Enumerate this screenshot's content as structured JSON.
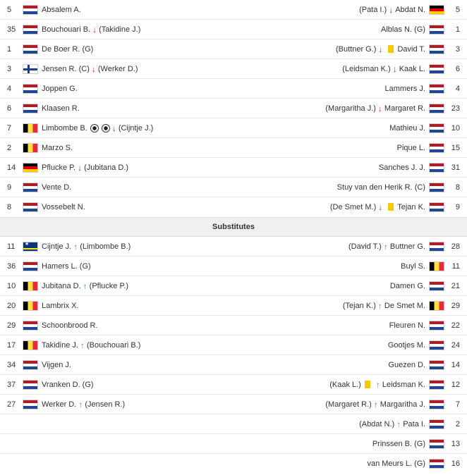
{
  "starting": [
    {
      "l_num": "5",
      "l_flag": "nl",
      "l_name": "Absalem A.",
      "l_extra": "",
      "r_pre": "(Pata I.)",
      "r_event": "down",
      "r_name": "Abdat N.",
      "r_flag": "de",
      "r_num": "5"
    },
    {
      "l_num": "35",
      "l_flag": "nl",
      "l_name": "Bouchouari B.",
      "l_event": "down",
      "l_extra": "(Takidine J.)",
      "r_pre": "",
      "r_event": "",
      "r_name": "Alblas N. (G)",
      "r_flag": "nl",
      "r_num": "1"
    },
    {
      "l_num": "1",
      "l_flag": "nl",
      "l_name": "De Boer R. (G)",
      "l_extra": "",
      "r_pre": "(Buttner G.)",
      "r_event": "down-yellow",
      "r_name": "David T.",
      "r_flag": "nl",
      "r_num": "3"
    },
    {
      "l_num": "3",
      "l_flag": "fi",
      "l_name": "Jensen R. (C)",
      "l_event": "down",
      "l_extra": "(Werker D.)",
      "r_pre": "(Leidsman K.)",
      "r_event": "down",
      "r_name": "Kaak L.",
      "r_flag": "nl",
      "r_num": "6"
    },
    {
      "l_num": "4",
      "l_flag": "nl",
      "l_name": "Joppen G.",
      "l_extra": "",
      "r_pre": "",
      "r_event": "",
      "r_name": "Lammers J.",
      "r_flag": "nl",
      "r_num": "4"
    },
    {
      "l_num": "6",
      "l_flag": "nl",
      "l_name": "Klaasen R.",
      "l_extra": "",
      "r_pre": "(Margaritha J.)",
      "r_event": "down",
      "r_name": "Margaret R.",
      "r_flag": "nl",
      "r_num": "23"
    },
    {
      "l_num": "7",
      "l_flag": "be",
      "l_name": "Limbombe B.",
      "l_event": "balls-down",
      "l_extra": "(Cijntje J.)",
      "r_pre": "",
      "r_event": "",
      "r_name": "Mathieu J.",
      "r_flag": "nl",
      "r_num": "10"
    },
    {
      "l_num": "2",
      "l_flag": "be",
      "l_name": "Marzo S.",
      "l_extra": "",
      "r_pre": "",
      "r_event": "",
      "r_name": "Pique L.",
      "r_flag": "nl",
      "r_num": "15"
    },
    {
      "l_num": "14",
      "l_flag": "de",
      "l_name": "Pflucke P.",
      "l_event": "down",
      "l_extra": "(Jubitana D.)",
      "r_pre": "",
      "r_event": "",
      "r_name": "Sanches J. J.",
      "r_flag": "nl",
      "r_num": "31"
    },
    {
      "l_num": "9",
      "l_flag": "nl",
      "l_name": "Vente D.",
      "l_extra": "",
      "r_pre": "",
      "r_event": "",
      "r_name": "Stuy van den Herik R. (C)",
      "r_flag": "nl",
      "r_num": "8"
    },
    {
      "l_num": "8",
      "l_flag": "nl",
      "l_name": "Vossebelt N.",
      "l_extra": "",
      "r_pre": "(De Smet M.)",
      "r_event": "down-yellow",
      "r_name": "Tejan K.",
      "r_flag": "nl",
      "r_num": "9"
    }
  ],
  "section_label": "Substitutes",
  "subs": [
    {
      "l_num": "11",
      "l_flag": "cw",
      "l_name": "Cijntje J.",
      "l_event": "up",
      "l_extra": "(Limbombe B.)",
      "r_pre": "(David T.)",
      "r_event": "up",
      "r_name": "Buttner G.",
      "r_flag": "nl",
      "r_num": "28"
    },
    {
      "l_num": "36",
      "l_flag": "nl",
      "l_name": "Hamers L. (G)",
      "l_extra": "",
      "r_pre": "",
      "r_event": "",
      "r_name": "Buyl S.",
      "r_flag": "be",
      "r_num": "11"
    },
    {
      "l_num": "10",
      "l_flag": "be",
      "l_name": "Jubitana D.",
      "l_event": "up",
      "l_extra": "(Pflucke P.)",
      "r_pre": "",
      "r_event": "",
      "r_name": "Damen G.",
      "r_flag": "nl",
      "r_num": "21"
    },
    {
      "l_num": "20",
      "l_flag": "be",
      "l_name": "Lambrix X.",
      "l_extra": "",
      "r_pre": "(Tejan K.)",
      "r_event": "up",
      "r_name": "De Smet M.",
      "r_flag": "be",
      "r_num": "29"
    },
    {
      "l_num": "29",
      "l_flag": "nl",
      "l_name": "Schoonbrood R.",
      "l_extra": "",
      "r_pre": "",
      "r_event": "",
      "r_name": "Fleuren N.",
      "r_flag": "nl",
      "r_num": "22"
    },
    {
      "l_num": "17",
      "l_flag": "be",
      "l_name": "Takidine J.",
      "l_event": "up",
      "l_extra": "(Bouchouari B.)",
      "r_pre": "",
      "r_event": "",
      "r_name": "Gootjes M.",
      "r_flag": "nl",
      "r_num": "24"
    },
    {
      "l_num": "34",
      "l_flag": "nl",
      "l_name": "Vijgen J.",
      "l_extra": "",
      "r_pre": "",
      "r_event": "",
      "r_name": "Guezen D.",
      "r_flag": "nl",
      "r_num": "14"
    },
    {
      "l_num": "37",
      "l_flag": "nl",
      "l_name": "Vranken D. (G)",
      "l_extra": "",
      "r_pre": "(Kaak L.)",
      "r_event": "yellow-up",
      "r_name": "Leidsman K.",
      "r_flag": "nl",
      "r_num": "12"
    },
    {
      "l_num": "27",
      "l_flag": "nl",
      "l_name": "Werker D.",
      "l_event": "up",
      "l_extra": "(Jensen R.)",
      "r_pre": "(Margaret R.)",
      "r_event": "up",
      "r_name": "Margaritha J.",
      "r_flag": "nl",
      "r_num": "7"
    },
    {
      "l_num": "",
      "l_flag": "",
      "l_name": "",
      "l_extra": "",
      "r_pre": "(Abdat N.)",
      "r_event": "up",
      "r_name": "Pata I.",
      "r_flag": "nl",
      "r_num": "2"
    },
    {
      "l_num": "",
      "l_flag": "",
      "l_name": "",
      "l_extra": "",
      "r_pre": "",
      "r_event": "",
      "r_name": "Prinssen B. (G)",
      "r_flag": "nl",
      "r_num": "13"
    },
    {
      "l_num": "",
      "l_flag": "",
      "l_name": "",
      "l_extra": "",
      "r_pre": "",
      "r_event": "",
      "r_name": "van Meurs L. (G)",
      "r_flag": "nl",
      "r_num": "16"
    }
  ],
  "icons": {
    "sub_out": "arrow-down-icon",
    "sub_in": "arrow-up-icon",
    "yellow_card": "yellow-card-icon",
    "goal": "ball-icon"
  },
  "colors": {
    "sub_out": "#d0202a",
    "sub_in": "#3aaa35",
    "yellow_card": "#f5c800",
    "section_bg": "#f0f0f0"
  }
}
